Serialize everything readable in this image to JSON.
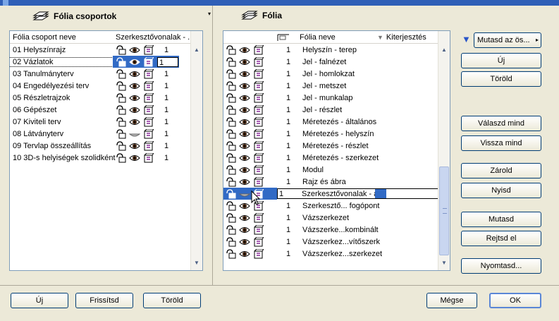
{
  "left_panel": {
    "title": "Fólia csoportok",
    "columns": {
      "name": "Fólia csoport neve",
      "editor": "Szerkesztővonalak - ..."
    },
    "rows": [
      {
        "name": "01 Helyszínrajz",
        "value": "1"
      },
      {
        "name": "02 Vázlatok",
        "value": "1"
      },
      {
        "name": "03 Tanulmányterv",
        "value": "1"
      },
      {
        "name": "04 Engedélyezési terv",
        "value": "1"
      },
      {
        "name": "05 Részletrajzok",
        "value": "1"
      },
      {
        "name": "06 Gépészet",
        "value": "1"
      },
      {
        "name": "07 Kiviteli terv",
        "value": "1"
      },
      {
        "name": "08 Látványterv",
        "value": "1"
      },
      {
        "name": "09 Tervlap összeállítás",
        "value": "1"
      },
      {
        "name": "10 3D-s helyiségek szolidként",
        "value": "1"
      }
    ],
    "buttons": {
      "new": "Új",
      "refresh": "Frissítsd",
      "delete": "Töröld"
    }
  },
  "right_panel": {
    "title": "Fólia",
    "columns": {
      "name": "Fólia neve",
      "ext": "Kiterjesztés"
    },
    "rows": [
      {
        "num": "1",
        "name": "Helyszín - terep"
      },
      {
        "num": "1",
        "name": "Jel - falnézet"
      },
      {
        "num": "1",
        "name": "Jel - homlokzat"
      },
      {
        "num": "1",
        "name": "Jel - metszet"
      },
      {
        "num": "1",
        "name": "Jel - munkalap"
      },
      {
        "num": "1",
        "name": "Jel - részlet"
      },
      {
        "num": "1",
        "name": "Méretezés - általános"
      },
      {
        "num": "1",
        "name": "Méretezés - helyszín"
      },
      {
        "num": "1",
        "name": "Méretezés - részlet"
      },
      {
        "num": "1",
        "name": "Méretezés - szerkezet"
      },
      {
        "num": "1",
        "name": "Modul"
      },
      {
        "num": "1",
        "name": "Rajz és ábra"
      },
      {
        "num": "1",
        "name": "Szerkesztővonalak - ált"
      },
      {
        "num": "1",
        "name": "Szerkesztő... fogópont"
      },
      {
        "num": "1",
        "name": "Vázszerkezet"
      },
      {
        "num": "1",
        "name": "Vázszerke...kombinált"
      },
      {
        "num": "1",
        "name": "Vázszerkez...vítőszerk"
      },
      {
        "num": "1",
        "name": "Vázszerkez...szerkezet"
      }
    ],
    "filter_label": "Mutasd az ös...",
    "side_buttons": {
      "new": "Új",
      "delete": "Töröld",
      "select_all": "Válaszd mind",
      "deselect_all": "Vissza mind",
      "lock": "Zárold",
      "unlock": "Nyisd",
      "show": "Mutasd",
      "hide": "Rejtsd el",
      "print": "Nyomtasd..."
    }
  },
  "footer": {
    "cancel": "Mégse",
    "ok": "OK"
  },
  "colors": {
    "selection": "#316ac5",
    "face": "#ece9d8",
    "border": "#7f9db9"
  }
}
